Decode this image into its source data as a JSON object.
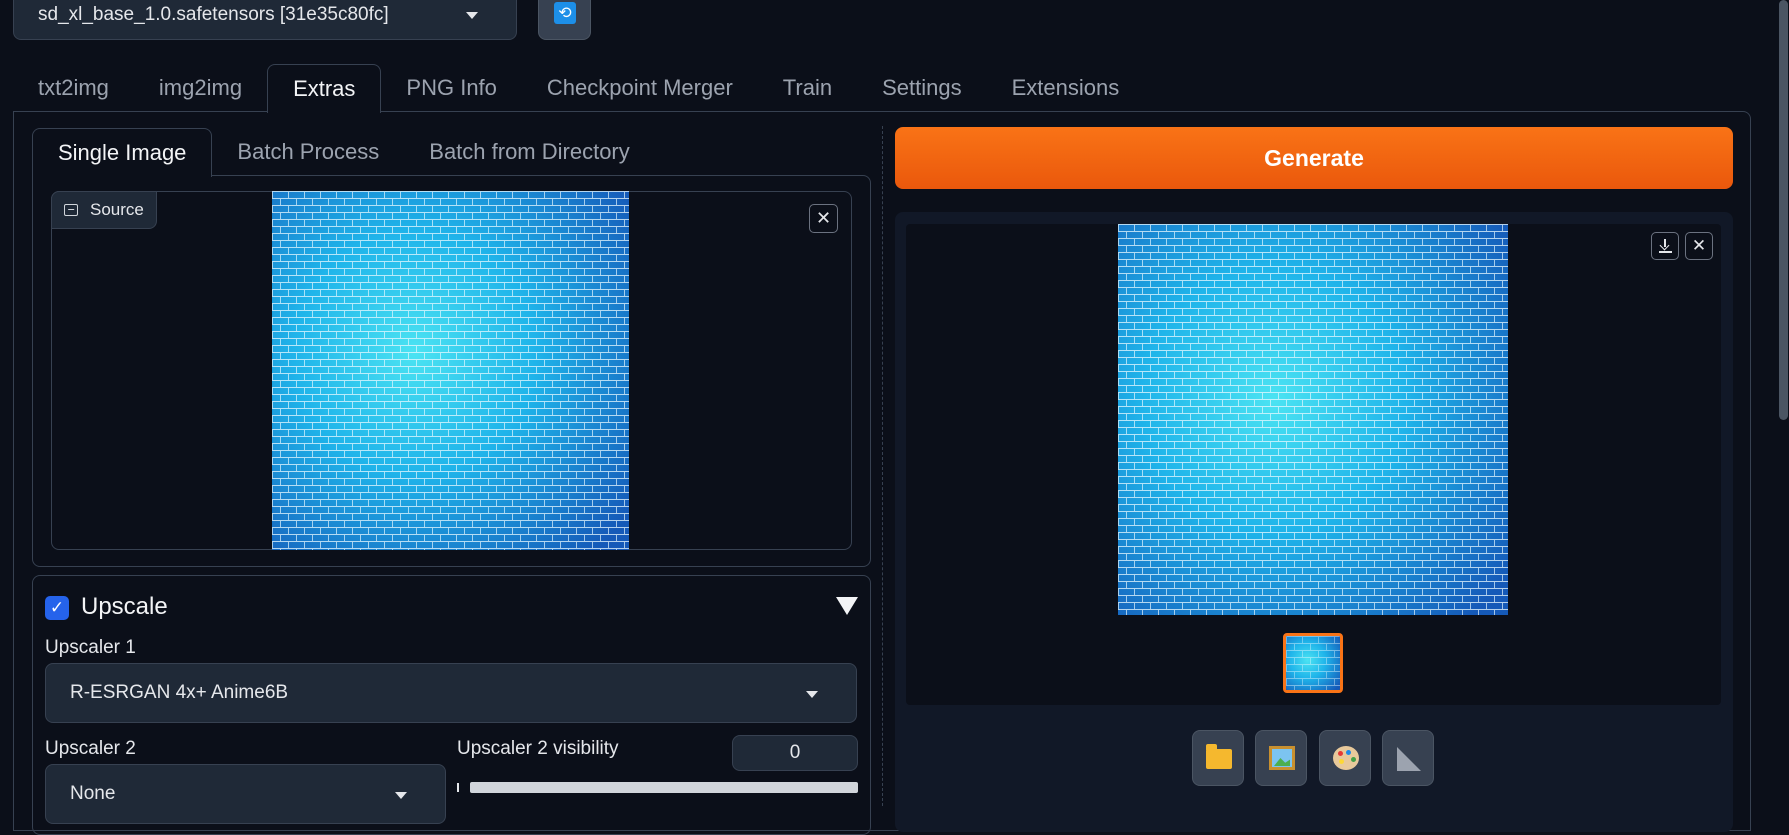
{
  "model": {
    "selected": "sd_xl_base_1.0.safetensors [31e35c80fc]"
  },
  "main_tabs": [
    "txt2img",
    "img2img",
    "Extras",
    "PNG Info",
    "Checkpoint Merger",
    "Train",
    "Settings",
    "Extensions"
  ],
  "active_main_tab": "Extras",
  "sub_tabs": [
    "Single Image",
    "Batch Process",
    "Batch from Directory"
  ],
  "active_sub_tab": "Single Image",
  "source": {
    "label": "Source"
  },
  "upscale": {
    "title": "Upscale",
    "checked": true,
    "upscaler1_label": "Upscaler 1",
    "upscaler1_value": "R-ESRGAN 4x+ Anime6B",
    "upscaler2_label": "Upscaler 2",
    "upscaler2_value": "None",
    "visibility_label": "Upscaler 2 visibility",
    "visibility_value": "0"
  },
  "generate": {
    "label": "Generate"
  },
  "icons": {
    "refresh": "refresh-icon",
    "folder": "folder-icon",
    "send_to_img2img": "framed-picture-icon",
    "send_to_inpaint": "palette-icon",
    "send_to_extras": "triangular-ruler-icon"
  },
  "colors": {
    "background": "#0b0f19",
    "panel": "#1f2937",
    "border": "#374151",
    "accent_orange": "#f97316",
    "checkbox_blue": "#2563eb"
  }
}
